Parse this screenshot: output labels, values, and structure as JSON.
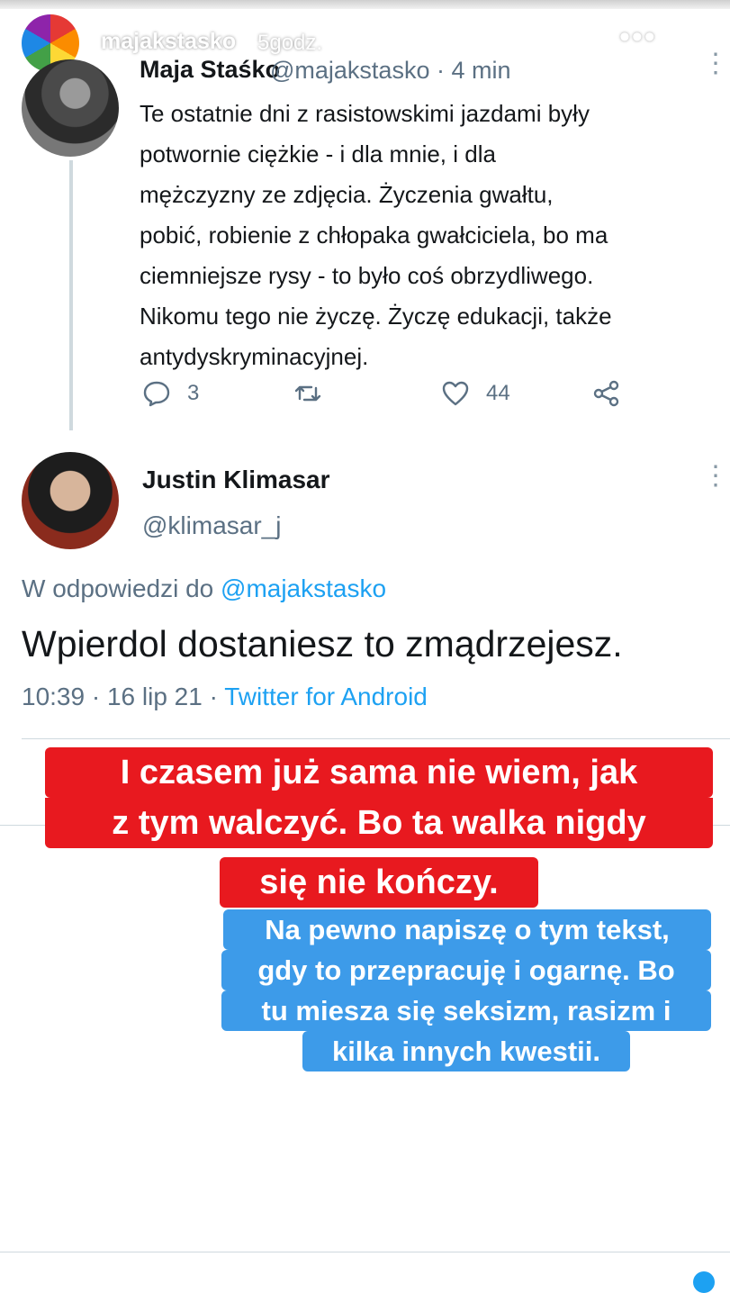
{
  "story": {
    "username": "majakstasko",
    "time": "5godz.",
    "more_label": "•••"
  },
  "tweet1": {
    "name": "Maja Staśko",
    "handle_time": "@majakstasko · 4 min",
    "menu": "⋮",
    "lines": [
      "Te ostatnie dni z rasistowskimi jazdami były",
      "potwornie ciężkie - i dla mnie, i dla",
      "mężczyzny ze zdjęcia. Życzenia gwałtu,",
      "pobić, robienie z chłopaka gwałciciela, bo ma",
      "ciemniejsze rysy - to było coś obrzydliwego.",
      "Nikomu tego nie życzę. Życzę edukacji, także",
      "antydyskryminacyjnej."
    ],
    "replies": "3",
    "likes": "44"
  },
  "tweet2": {
    "name": "Justin Klimasar",
    "handle": "@klimasar_j",
    "menu": "⋮",
    "reply_prefix": "W odpowiedzi do ",
    "reply_handle": "@majakstasko",
    "text": "Wpierdol dostaniesz to zmądrzejesz.",
    "date": "10:39 · 16 lip 21 · ",
    "source": "Twitter for Android"
  },
  "captions": {
    "red": [
      "I czasem już sama nie wiem, jak",
      "z tym walczyć. Bo ta walka nigdy",
      "się nie kończy."
    ],
    "blue": [
      "Na pewno napiszę o tym tekst,",
      "gdy to przepracuję i ogarnę. Bo",
      "tu miesza się seksizm, rasizm i",
      "kilka innych kwestii."
    ]
  },
  "colors": {
    "twitter_blue": "#1da1f2",
    "caption_red": "#e8191f",
    "caption_blue": "#3d9be9",
    "secondary_text": "#5b7083"
  },
  "icons": {
    "reply": "reply-icon",
    "retweet": "retweet-icon",
    "like": "heart-icon",
    "share": "share-icon",
    "close": "close-icon"
  }
}
